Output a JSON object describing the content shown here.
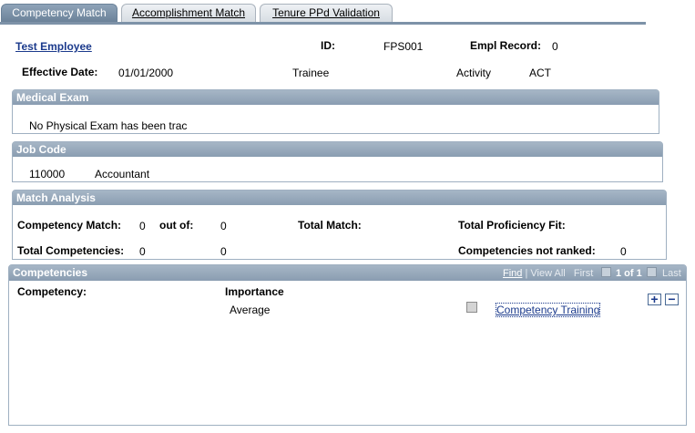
{
  "tabs": [
    {
      "label": "Competency Match",
      "active": true
    },
    {
      "label": "Accomplishment Match",
      "active": false
    },
    {
      "label": "Tenure PPd Validation",
      "active": false
    }
  ],
  "employee": {
    "name_link": "Test Employee",
    "id_label": "ID:",
    "id_value": "FPS001",
    "empl_record_label": "Empl Record:",
    "empl_record_value": "0",
    "effective_date_label": "Effective Date:",
    "effective_date_value": "01/01/2000",
    "job_title": "Trainee",
    "action_label": "Activity",
    "action_value": "ACT"
  },
  "medical_exam": {
    "title": "Medical Exam",
    "text": "No Physical Exam has been trac"
  },
  "job_code": {
    "title": "Job Code",
    "code": "110000",
    "description": "Accountant"
  },
  "match_analysis": {
    "title": "Match Analysis",
    "competency_match_label": "Competency Match:",
    "competency_match_value": "0",
    "out_of_label": "out of:",
    "out_of_value": "0",
    "total_match_label": "Total Match:",
    "total_proficiency_fit_label": "Total Proficiency Fit:",
    "total_competencies_label": "Total Competencies:",
    "total_competencies_value": "0",
    "total_competencies_value2": "0",
    "not_ranked_label": "Competencies not ranked:",
    "not_ranked_value": "0"
  },
  "competencies": {
    "title": "Competencies",
    "nav": {
      "find": "Find",
      "separator": "|",
      "view_all": "View All",
      "first": "First",
      "count": "1 of 1",
      "last": "Last"
    },
    "col_competency": "Competency:",
    "col_importance": "Importance",
    "row": {
      "importance": "Average",
      "link": "Competency Training"
    },
    "add_symbol": "+",
    "remove_symbol": "−"
  },
  "colors": {
    "active_tab": "#6b8299",
    "header_bar": "#8a9db1",
    "link": "#1b3a8c"
  }
}
